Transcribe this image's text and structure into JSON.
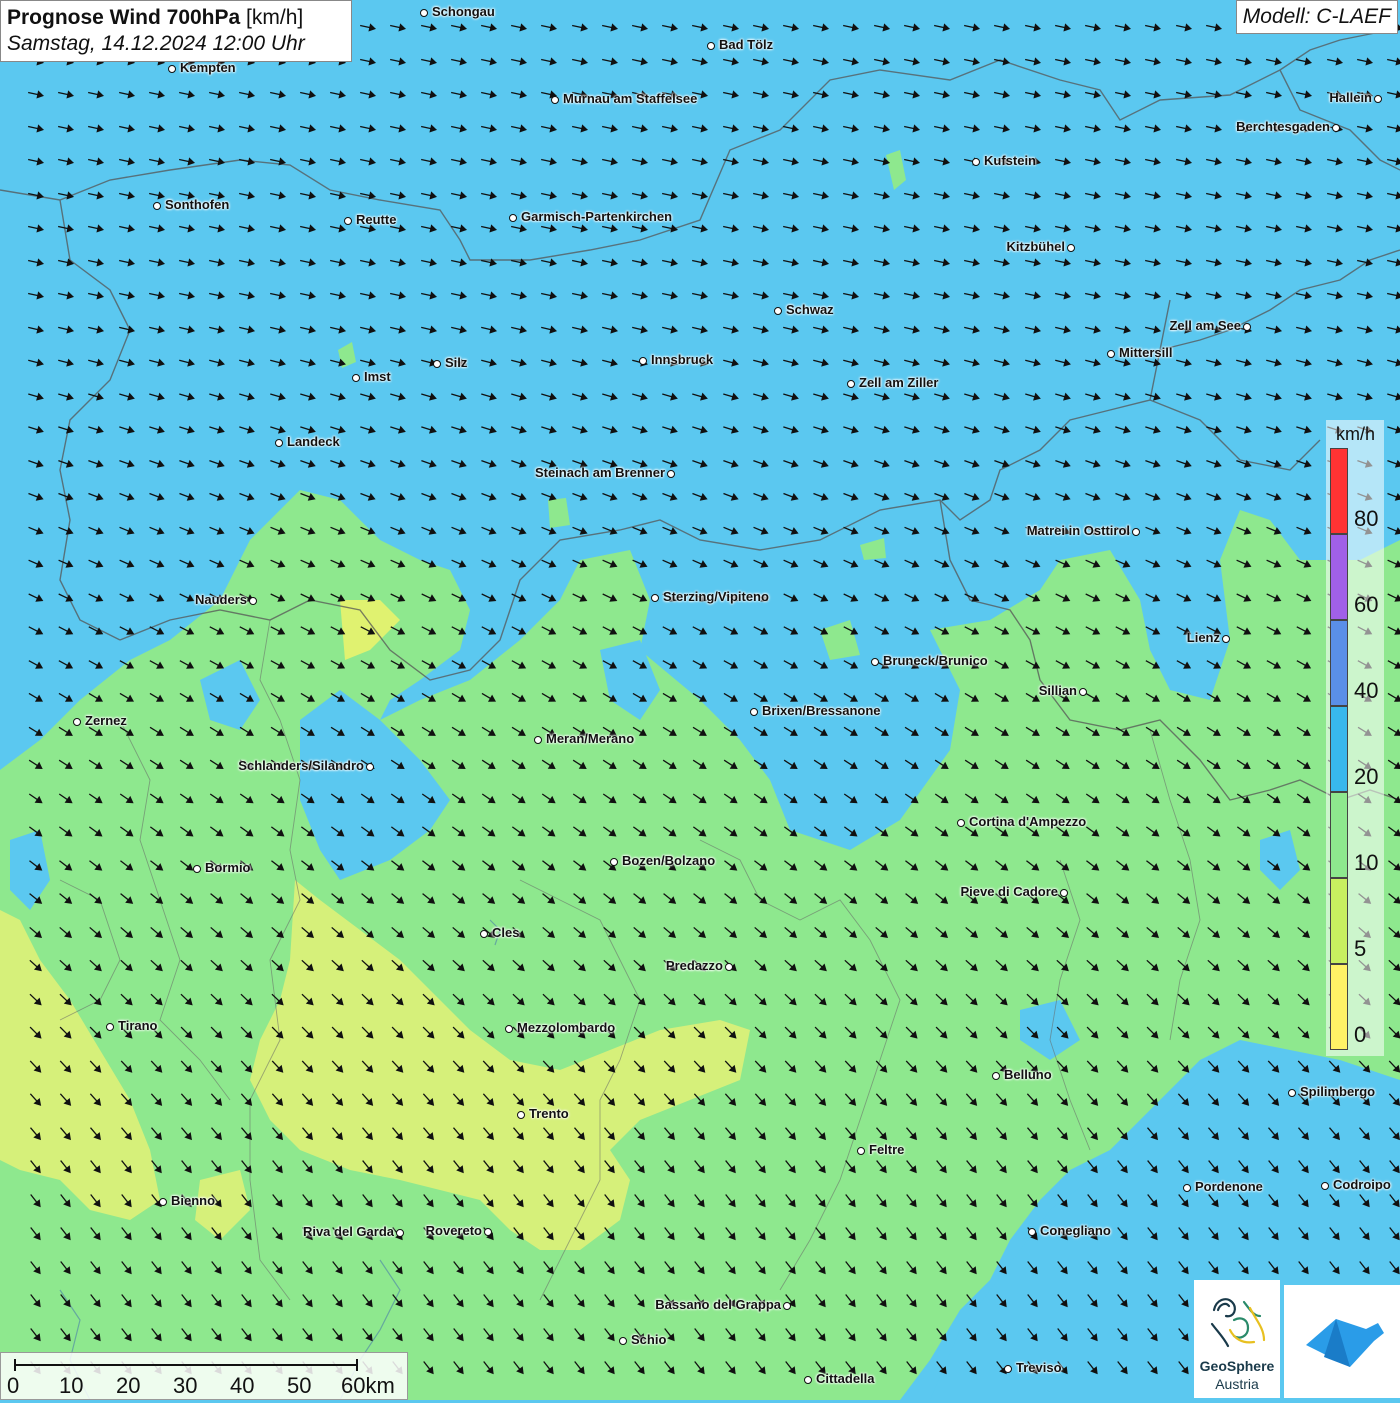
{
  "header": {
    "title_bold": "Prognose Wind 700hPa",
    "title_unit": " [km/h]",
    "subtitle": "Samstag, 14.12.2024 12:00 Uhr",
    "model": "Modell: C-LAEF"
  },
  "cities": [
    {
      "name": "Schongau"
    },
    {
      "name": "Bad Tölz"
    },
    {
      "name": "Kempten"
    },
    {
      "name": "Murnau am Staffelsee"
    },
    {
      "name": "Hallein"
    },
    {
      "name": "Berchtesgaden"
    },
    {
      "name": "Kufstein"
    },
    {
      "name": "Sonthofen"
    },
    {
      "name": "Reutte"
    },
    {
      "name": "Garmisch-Partenkirchen"
    },
    {
      "name": "Kitzbühel"
    },
    {
      "name": "Schwaz"
    },
    {
      "name": "Zell am See"
    },
    {
      "name": "Mittersill"
    },
    {
      "name": "Innsbruck"
    },
    {
      "name": "Silz"
    },
    {
      "name": "Imst"
    },
    {
      "name": "Zell am Ziller"
    },
    {
      "name": "Landeck"
    },
    {
      "name": "Steinach am Brenner"
    },
    {
      "name": "Matrei in Osttirol"
    },
    {
      "name": "Nauders"
    },
    {
      "name": "Sterzing/Vipiteno"
    },
    {
      "name": "Lienz"
    },
    {
      "name": "Bruneck/Brunico"
    },
    {
      "name": "Sillian"
    },
    {
      "name": "Zernez"
    },
    {
      "name": "Brixen/Bressanone"
    },
    {
      "name": "Meran/Merano"
    },
    {
      "name": "Schlanders/Silandro"
    },
    {
      "name": "Cortina d'Ampezzo"
    },
    {
      "name": "Bozen/Bolzano"
    },
    {
      "name": "Bormio"
    },
    {
      "name": "Pieve di Cadore"
    },
    {
      "name": "Cles"
    },
    {
      "name": "Predazzo"
    },
    {
      "name": "Tirano"
    },
    {
      "name": "Mezzolombardo"
    },
    {
      "name": "Belluno"
    },
    {
      "name": "Spilimbergo"
    },
    {
      "name": "Trento"
    },
    {
      "name": "Feltre"
    },
    {
      "name": "Pordenone"
    },
    {
      "name": "Codroipo"
    },
    {
      "name": "Bienno"
    },
    {
      "name": "Riva del Garda"
    },
    {
      "name": "Rovereto"
    },
    {
      "name": "Conegliano"
    },
    {
      "name": "Bassano del Grappa"
    },
    {
      "name": "Schio"
    },
    {
      "name": "Treviso"
    },
    {
      "name": "Cittadella"
    }
  ],
  "legend": {
    "unit": "km/h",
    "ticks": [
      "80",
      "60",
      "40",
      "20",
      "10",
      "5",
      "0"
    ],
    "colors": [
      "#ff3333",
      "#a060e8",
      "#5a8fe8",
      "#38b8ec",
      "#8ee88e",
      "#c8f060",
      "#fff266"
    ]
  },
  "scalebar": {
    "labels": [
      "0",
      "10",
      "20",
      "30",
      "40",
      "50",
      "60km"
    ]
  },
  "logos": {
    "geosphere_line1": "GeoSphere",
    "geosphere_line2": "Austria"
  },
  "colors": {
    "wind_10_20": "#8ee88e",
    "wind_20_40": "#5bc8f0",
    "wind_5_10": "#d6f07a",
    "arrow": "#111111"
  }
}
